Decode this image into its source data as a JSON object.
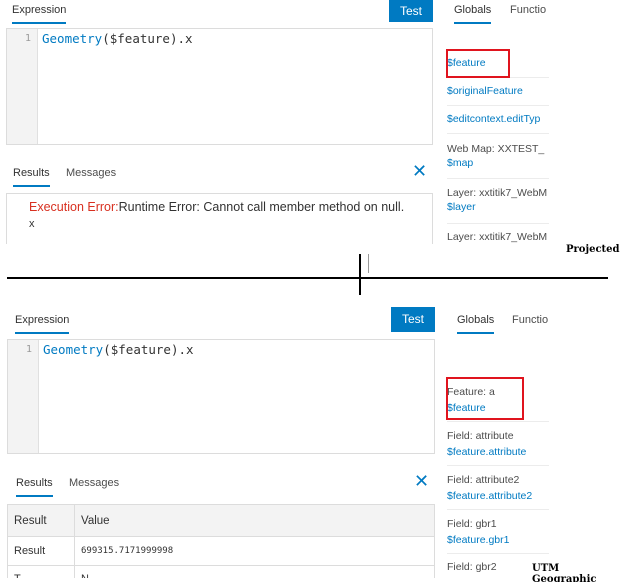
{
  "top": {
    "tab_expression": "Expression",
    "test_label": "Test",
    "tab_globals": "Globals",
    "tab_functions": "Functio",
    "line_number": "1",
    "code_fn": "Geometry",
    "code_rest": "($feature).x",
    "results_tab": "Results",
    "messages_tab": "Messages",
    "close_glyph": "✕",
    "error_label": "Execution Error:",
    "error_text": "Runtime Error: Cannot call member method on null.",
    "error_line2": "x",
    "globals": [
      {
        "label": "",
        "value": "$feature"
      },
      {
        "label": "",
        "value": "$originalFeature"
      },
      {
        "label": "",
        "value": "$editcontext.editTyp"
      },
      {
        "label": "Web Map: XXTEST_",
        "value": "$map"
      },
      {
        "label": "Layer: xxtitik7_WebM",
        "value": "$layer"
      },
      {
        "label": "Layer: xxtitik7_WebM",
        "value": ""
      }
    ],
    "caption": "Projected"
  },
  "bottom": {
    "tab_expression": "Expression",
    "test_label": "Test",
    "tab_globals": "Globals",
    "tab_functions": "Functio",
    "line_number": "1",
    "code_fn": "Geometry",
    "code_rest": "($feature).x",
    "results_tab": "Results",
    "messages_tab": "Messages",
    "close_glyph": "✕",
    "table_header": [
      "Result",
      "Value"
    ],
    "table_row1": [
      "Result",
      "699315.7171999998"
    ],
    "table_row2": [
      "T",
      "N"
    ],
    "globals": [
      {
        "label": "Feature: a",
        "value": "$feature"
      },
      {
        "label": "Field: attribute",
        "value": "$feature.attribute"
      },
      {
        "label": "Field: attribute2",
        "value": "$feature.attribute2"
      },
      {
        "label": "Field: gbr1",
        "value": "$feature.gbr1"
      },
      {
        "label": "Field: gbr2",
        "value": ""
      }
    ],
    "caption": "UTM Geographic"
  },
  "colors": {
    "accent": "#007ac2",
    "error": "#d83020",
    "highlight": "#e0141e"
  }
}
